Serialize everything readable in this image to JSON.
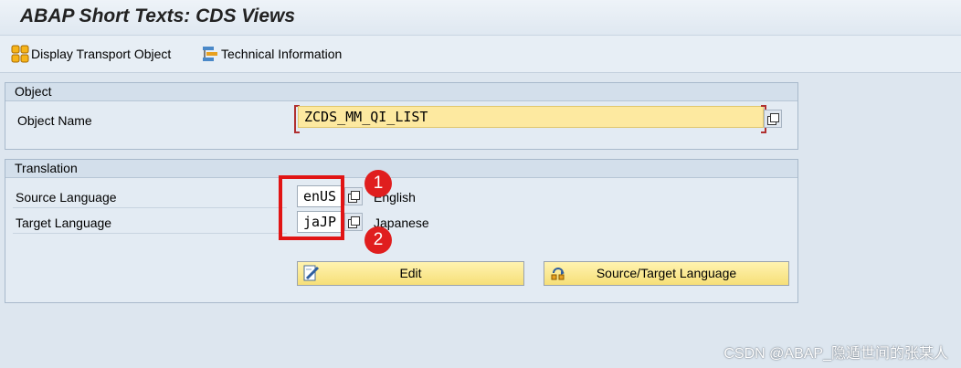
{
  "window": {
    "title": "ABAP Short Texts: CDS Views"
  },
  "toolbar": {
    "display_transport_label": "Display Transport Object",
    "technical_info_label": "Technical Information"
  },
  "object_panel": {
    "header": "Object",
    "object_name_label": "Object Name",
    "object_name_value": "ZCDS_MM_QI_LIST"
  },
  "translation_panel": {
    "header": "Translation",
    "source_label": "Source Language",
    "source_value": "enUS",
    "source_desc": "English",
    "target_label": "Target Language",
    "target_value": "jaJP",
    "target_desc": "Japanese",
    "edit_label": "Edit",
    "source_target_label": "Source/Target Language"
  },
  "annotations": {
    "badge_1": "1",
    "badge_2": "2"
  },
  "watermark": "CSDN @ABAP_隐遁世间的张某人",
  "colors": {
    "background": "#dde6ef",
    "required_field": "#fde9a0",
    "button_yellow": "#f6df78",
    "highlight_red": "#e11414"
  },
  "icons": {
    "display_transport": "transport-object-icon",
    "technical_info": "technical-info-icon",
    "edit": "edit-pencil-icon",
    "source_target": "language-switch-icon",
    "value_help": "value-help-icon"
  }
}
